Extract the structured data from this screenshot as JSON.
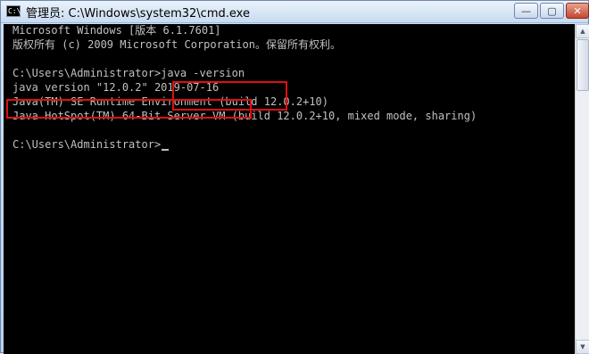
{
  "window": {
    "title": "管理员: C:\\Windows\\system32\\cmd.exe",
    "icon_text": "C:\\",
    "minimize_glyph": "—",
    "maximize_glyph": "▢",
    "close_glyph": "✕"
  },
  "console": {
    "lines": [
      "Microsoft Windows [版本 6.1.7601]",
      "版权所有 (c) 2009 Microsoft Corporation。保留所有权利。",
      "",
      "C:\\Users\\Administrator>java -version",
      "java version \"12.0.2\" 2019-07-16",
      "Java(TM) SE Runtime Environment (build 12.0.2+10)",
      "Java HotSpot(TM) 64-Bit Server VM (build 12.0.2+10, mixed mode, sharing)",
      "",
      "C:\\Users\\Administrator>"
    ]
  },
  "colors": {
    "console_bg": "#000000",
    "console_text": "#c0c0c0",
    "highlight": "#e01010"
  },
  "icons": {
    "app": "cmd-icon",
    "scroll_up": "arrow-up-icon",
    "scroll_down": "arrow-down-icon"
  }
}
